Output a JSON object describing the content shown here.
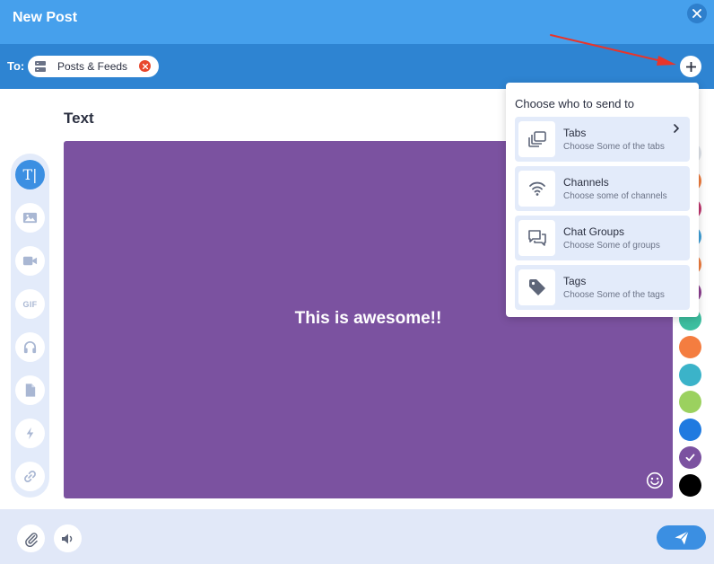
{
  "window": {
    "title": "New Post",
    "close_icon": "close-icon"
  },
  "recipients": {
    "to_label": "To:",
    "chips": [
      {
        "label": "Posts & Feeds",
        "icon": "feed-icon",
        "remove_icon": "remove-icon"
      }
    ],
    "add_icon": "plus-icon"
  },
  "annotation": {
    "arrow_color": "#e8352b"
  },
  "editor": {
    "section_title": "Text",
    "canvas_text": "This is awesome!!",
    "canvas_color": "#7b52a0",
    "emoji_icon": "smiley-icon"
  },
  "toolbar": {
    "tools": [
      {
        "name": "text",
        "icon": "text-icon",
        "glyph": "T|",
        "active": true
      },
      {
        "name": "image",
        "icon": "image-icon",
        "active": false
      },
      {
        "name": "video",
        "icon": "video-icon",
        "active": false
      },
      {
        "name": "gif",
        "icon": "gif-icon",
        "label": "GIF",
        "active": false
      },
      {
        "name": "audio",
        "icon": "headphones-icon",
        "active": false
      },
      {
        "name": "file",
        "icon": "file-icon",
        "active": false
      },
      {
        "name": "flash",
        "icon": "lightning-icon",
        "active": false
      },
      {
        "name": "link",
        "icon": "link-icon",
        "active": false
      }
    ]
  },
  "colors": {
    "swatches": [
      "#dfe3ea",
      "#f07c3e",
      "#c0356e",
      "#3fa0d8",
      "#f07c3e",
      "#8d3f90",
      "#3dbfa0",
      "#f47d40",
      "#3bb3c9",
      "#9bd15f",
      "#1f7ae0",
      "#7b52a0",
      "#000000"
    ],
    "selected": "#7b52a0"
  },
  "dropdown": {
    "heading": "Choose who to send to",
    "items": [
      {
        "title": "Tabs",
        "subtitle": "Choose Some of the tabs",
        "icon": "tabs-icon",
        "has_chevron": true
      },
      {
        "title": "Channels",
        "subtitle": "Choose some of channels",
        "icon": "wifi-icon",
        "has_chevron": false
      },
      {
        "title": "Chat Groups",
        "subtitle": "Choose Some of groups",
        "icon": "chat-icon",
        "has_chevron": false
      },
      {
        "title": "Tags",
        "subtitle": "Choose Some of the tags",
        "icon": "tag-icon",
        "has_chevron": false
      }
    ]
  },
  "footer": {
    "attach_icon": "paperclip-icon",
    "sound_icon": "speaker-icon",
    "send_icon": "send-icon"
  }
}
